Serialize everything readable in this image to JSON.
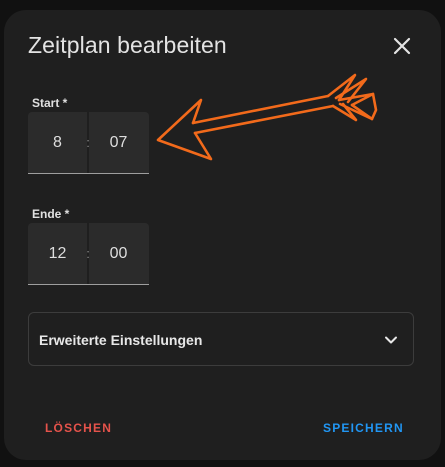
{
  "dialog": {
    "title": "Zeitplan bearbeiten",
    "close_icon": "close-icon"
  },
  "start": {
    "label": "Start *",
    "hour": "8",
    "minute": "07",
    "separator": ":"
  },
  "end": {
    "label": "Ende *",
    "hour": "12",
    "minute": "00",
    "separator": ":"
  },
  "advanced": {
    "label": "Erweiterte Einstellungen",
    "icon": "chevron-down-icon"
  },
  "actions": {
    "delete_label": "LÖSCHEN",
    "save_label": "SPEICHERN"
  },
  "colors": {
    "background": "#1f1f1f",
    "delete": "#e5534b",
    "save": "#2196f3",
    "annotation_arrow": "#f26a1b"
  }
}
